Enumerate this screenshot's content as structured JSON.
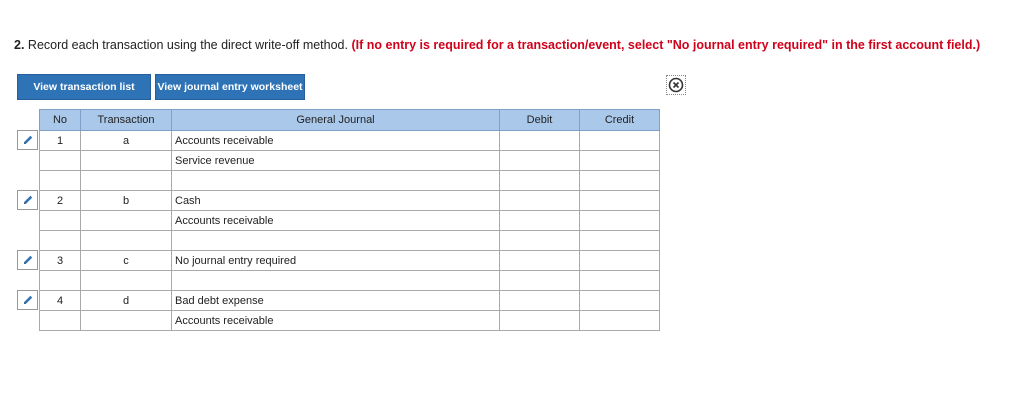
{
  "instruction": {
    "number": "2.",
    "text": " Record each transaction using the direct write-off method.",
    "note": " (If no entry is required for a transaction/event, select \"No journal entry required\" in the first account field.)"
  },
  "buttons": {
    "view_transaction_list": "View transaction list",
    "view_journal_worksheet": "View journal entry worksheet"
  },
  "table": {
    "headers": [
      "No",
      "Transaction",
      "General Journal",
      "Debit",
      "Credit"
    ],
    "rows": [
      {
        "no": "1",
        "tx": "a",
        "account": "Accounts receivable",
        "debit": "",
        "credit": ""
      },
      {
        "no": "",
        "tx": "",
        "account": "Service revenue",
        "debit": "",
        "credit": ""
      },
      {
        "no": "",
        "tx": "",
        "account": "",
        "debit": "",
        "credit": ""
      },
      {
        "no": "2",
        "tx": "b",
        "account": "Cash",
        "debit": "",
        "credit": ""
      },
      {
        "no": "",
        "tx": "",
        "account": "Accounts receivable",
        "debit": "",
        "credit": ""
      },
      {
        "no": "",
        "tx": "",
        "account": "",
        "debit": "",
        "credit": ""
      },
      {
        "no": "3",
        "tx": "c",
        "account": "No journal entry required",
        "debit": "",
        "credit": ""
      },
      {
        "no": "",
        "tx": "",
        "account": "",
        "debit": "",
        "credit": ""
      },
      {
        "no": "4",
        "tx": "d",
        "account": "Bad debt expense",
        "debit": "",
        "credit": ""
      },
      {
        "no": "",
        "tx": "",
        "account": "Accounts receivable",
        "debit": "",
        "credit": ""
      }
    ]
  },
  "colors": {
    "button": "#2f73b7",
    "header": "#aac8ea",
    "note_red": "#d0021b"
  },
  "icons": {
    "edit": "pencil-icon",
    "close": "close-circle-icon"
  }
}
